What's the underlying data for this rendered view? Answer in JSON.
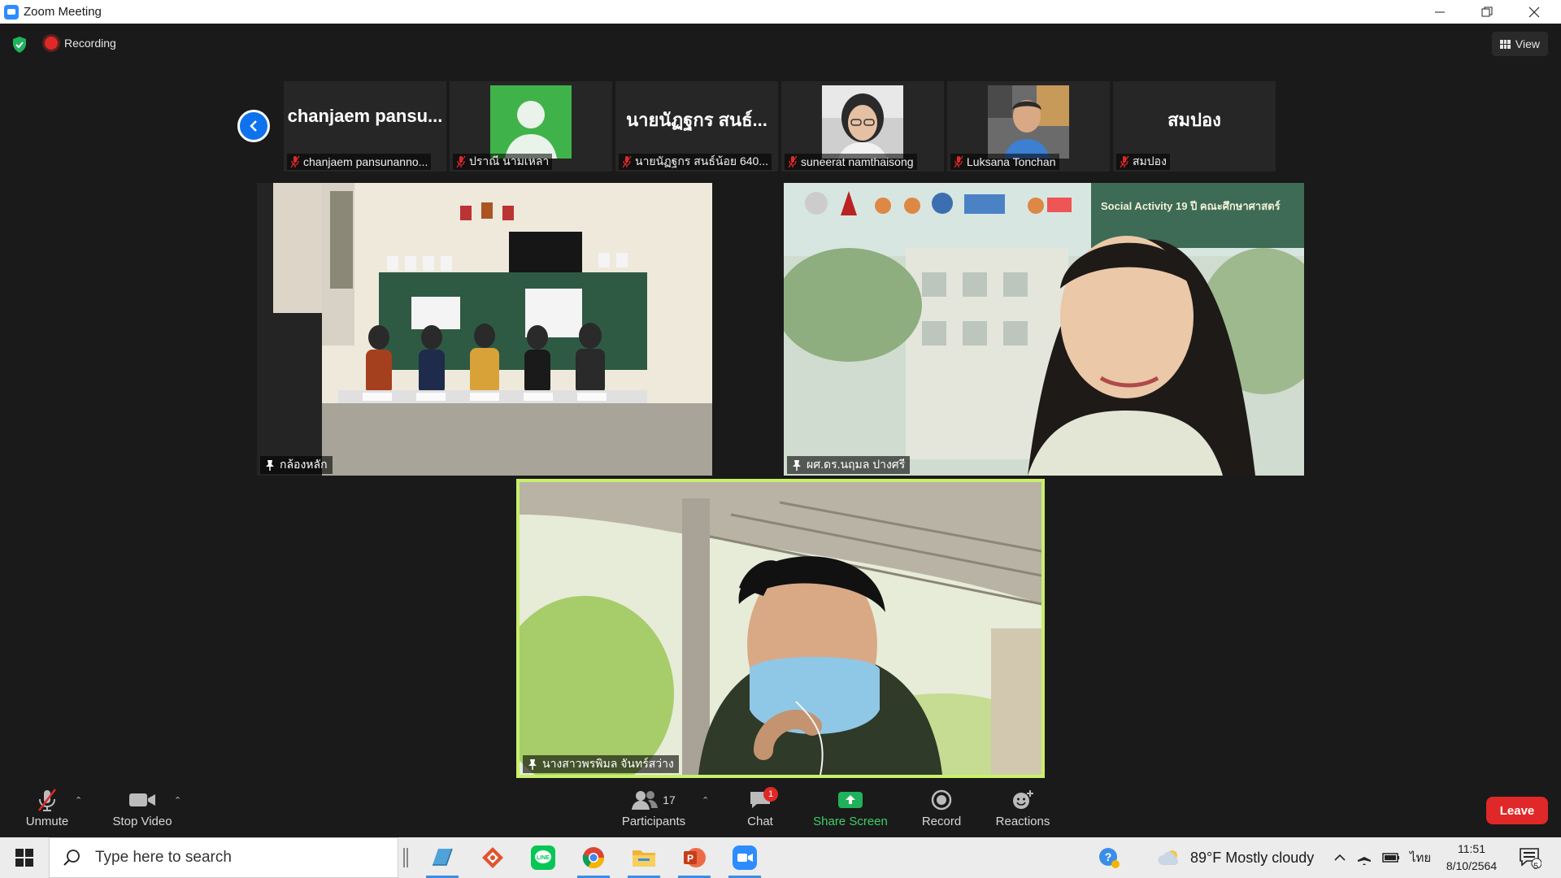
{
  "window": {
    "title": "Zoom Meeting"
  },
  "meeting": {
    "recording_label": "Recording",
    "view_label": "View",
    "strip": [
      {
        "big_name": "chanjaem  pansu...",
        "label": "chanjaem pansunanno...",
        "has_photo": false
      },
      {
        "big_name": "",
        "label": "ปราณี นามเหลา",
        "has_photo": "avatar"
      },
      {
        "big_name": "นายนัฏฐกร สนธ์...",
        "label": "นายนัฏฐกร สนธ์น้อย 640...",
        "has_photo": false
      },
      {
        "big_name": "",
        "label": "suneerat namthaisong",
        "has_photo": "face-woman"
      },
      {
        "big_name": "",
        "label": "Luksana Tonchan",
        "has_photo": "face-boy"
      },
      {
        "big_name": "สมปอง",
        "label": "สมปอง",
        "has_photo": false
      }
    ],
    "videos": {
      "classroom": {
        "label": "กล้องหลัก"
      },
      "presenter": {
        "label": "ผศ.ดร.นฤมล ปางศรี",
        "banner": "Social Activity 19 ปี คณะศึกษาศาสตร์"
      },
      "speaker": {
        "label": "นางสาวพรพิมล จันทร์สว่าง"
      }
    }
  },
  "toolbar": {
    "unmute": "Unmute",
    "stop_video": "Stop Video",
    "participants": "Participants",
    "participants_count": "17",
    "chat": "Chat",
    "chat_badge": "1",
    "share": "Share Screen",
    "record": "Record",
    "reactions": "Reactions",
    "leave": "Leave"
  },
  "taskbar": {
    "search_placeholder": "Type here to search",
    "weather": "89°F  Mostly cloudy",
    "lang": "ไทย",
    "time": "11:51",
    "date": "8/10/2564",
    "notif_count": "5"
  },
  "colors": {
    "accent": "#0e72ed",
    "share_green": "#3ecf6a",
    "leave_red": "#e02828",
    "active_speaker": "#c8f06a"
  }
}
